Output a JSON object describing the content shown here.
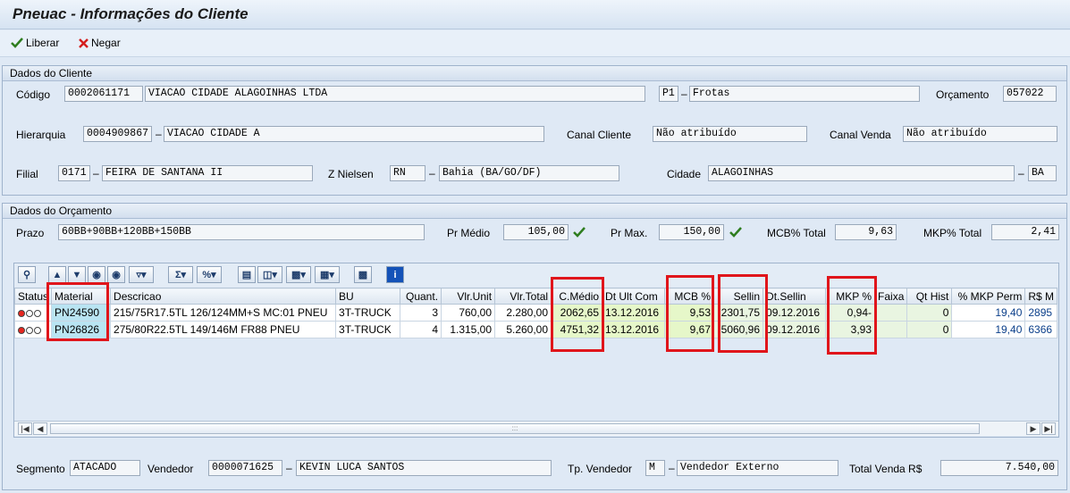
{
  "window": {
    "title": "Pneuac - Informações do Cliente"
  },
  "toolbar": {
    "liberar": "Liberar",
    "negar": "Negar"
  },
  "cliente": {
    "header": "Dados do Cliente",
    "codigo_label": "Código",
    "codigo": "0002061171",
    "nome": "VIACAO CIDADE ALAGOINHAS LTDA",
    "tipo_code": "P1",
    "tipo": "Frotas",
    "orcamento_label": "Orçamento",
    "orcamento": "057022",
    "hierarquia_label": "Hierarquia",
    "hierarquia": "0004909867",
    "hierarquia_nome": "VIACAO CIDADE A",
    "canal_cliente_label": "Canal Cliente",
    "canal_cliente": "Não atribuído",
    "canal_venda_label": "Canal Venda",
    "canal_venda": "Não atribuído",
    "filial_label": "Filial",
    "filial": "0171",
    "filial_nome": "FEIRA DE SANTANA II",
    "znielsen_label": "Z Nielsen",
    "znielsen": "RN",
    "znielsen_desc": "Bahia (BA/GO/DF)",
    "cidade_label": "Cidade",
    "cidade": "ALAGOINHAS",
    "uf": "BA"
  },
  "orcamento": {
    "header": "Dados do Orçamento",
    "prazo_label": "Prazo",
    "prazo": "60BB+90BB+120BB+150BB",
    "pr_medio_label": "Pr Médio",
    "pr_medio": "105,00",
    "pr_max_label": "Pr Max.",
    "pr_max": "150,00",
    "mcb_total_label": "MCB% Total",
    "mcb_total": "9,63",
    "mkp_total_label": "MKP% Total",
    "mkp_total": "2,41"
  },
  "grid": {
    "columns": [
      "Status",
      "Material",
      "Descricao",
      "BU",
      "Quant.",
      "Vlr.Unit",
      "Vlr.Total",
      "C.Médio",
      "Dt Ult Com",
      "MCB %",
      "Sellin",
      "Dt.Sellin",
      "MKP %",
      "Faixa",
      "Qt Hist",
      "% MKP Perm",
      "R$ M"
    ],
    "rows": [
      {
        "material": "PN24590",
        "descricao": "215/75R17.5TL 126/124MM+S MC:01 PNEU",
        "bu": "3T-TRUCK",
        "quant": "3",
        "vlr_unit": "760,00",
        "vlr_total": "2.280,00",
        "c_medio": "2062,65",
        "dt_ult_com": "13.12.2016",
        "mcb": "9,53",
        "sellin": "2301,75",
        "dt_sellin": "09.12.2016",
        "mkp": "0,94-",
        "faixa": "",
        "qt_hist": "0",
        "mkp_perm": "19,40",
        "rs_m": "2895"
      },
      {
        "material": "PN26826",
        "descricao": "275/80R22.5TL 149/146M FR88 PNEU",
        "bu": "3T-TRUCK",
        "quant": "4",
        "vlr_unit": "1.315,00",
        "vlr_total": "5.260,00",
        "c_medio": "4751,32",
        "dt_ult_com": "13.12.2016",
        "mcb": "9,67",
        "sellin": "5060,96",
        "dt_sellin": "09.12.2016",
        "mkp": "3,93",
        "faixa": "",
        "qt_hist": "0",
        "mkp_perm": "19,40",
        "rs_m": "6366"
      }
    ]
  },
  "footer": {
    "segmento_label": "Segmento",
    "segmento": "ATACADO",
    "vendedor_label": "Vendedor",
    "vendedor": "0000071625",
    "vendedor_nome": "KEVIN LUCA SANTOS",
    "tp_vendedor_label": "Tp. Vendedor",
    "tp_vendedor": "M",
    "tp_vendedor_desc": "Vendedor Externo",
    "total_label": "Total Venda R$",
    "total": "7.540,00"
  },
  "colors": {
    "highlight": "#e0151b",
    "key_cell": "#b9e4f2",
    "calc_cell": "#e6f7c9"
  }
}
